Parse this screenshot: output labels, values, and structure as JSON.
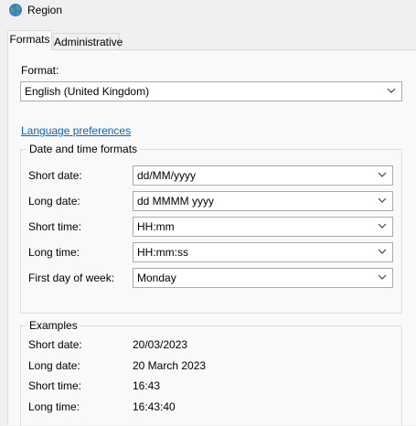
{
  "window": {
    "title": "Region"
  },
  "tabs": [
    {
      "label": "Formats"
    },
    {
      "label": "Administrative"
    }
  ],
  "format": {
    "label": "Format:",
    "value": "English (United Kingdom)"
  },
  "language_link": "Language preferences",
  "date_time_formats": {
    "title": "Date and time formats",
    "rows": [
      {
        "label": "Short date:",
        "value": "dd/MM/yyyy"
      },
      {
        "label": "Long date:",
        "value": "dd MMMM yyyy"
      },
      {
        "label": "Short time:",
        "value": "HH:mm"
      },
      {
        "label": "Long time:",
        "value": "HH:mm:ss"
      },
      {
        "label": "First day of week:",
        "value": "Monday"
      }
    ]
  },
  "examples": {
    "title": "Examples",
    "rows": [
      {
        "label": "Short date:",
        "value": "20/03/2023"
      },
      {
        "label": "Long date:",
        "value": "20 March 2023"
      },
      {
        "label": "Short time:",
        "value": "16:43"
      },
      {
        "label": "Long time:",
        "value": "16:43:40"
      }
    ]
  },
  "icons": {
    "app": "globe-icon",
    "dropdown": "chevron-down-icon"
  }
}
